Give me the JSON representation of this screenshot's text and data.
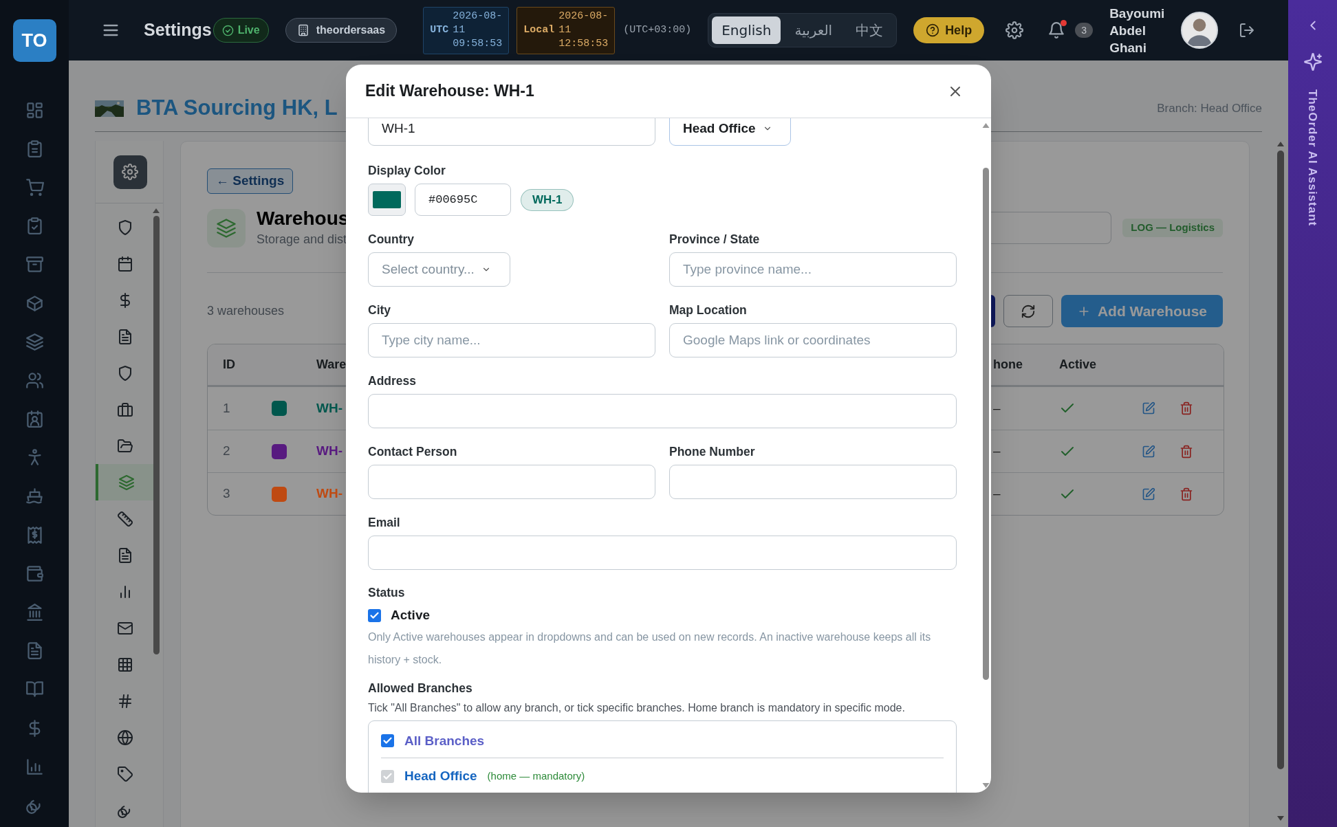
{
  "topbar": {
    "logo": "TO",
    "title": "Settings",
    "live": "Live",
    "tenant": "theordersaas",
    "clocks": [
      {
        "kind": "utc",
        "label": "UTC",
        "date": "2026-08-11",
        "time": "09:58:53"
      },
      {
        "kind": "local",
        "label": "Local",
        "date": "2026-08-11",
        "time": "12:58:53"
      }
    ],
    "timezone": "(UTC+03:00)",
    "languages": [
      {
        "label": "English",
        "selected": true
      },
      {
        "label": "العربية",
        "selected": false
      },
      {
        "label": "中文",
        "selected": false
      }
    ],
    "help": "Help",
    "notifications": "3",
    "user": "Bayoumi Abdel Ghani"
  },
  "ai_panel": {
    "title": "TheOrder AI Assistant"
  },
  "header": {
    "company": "BTA Sourcing HK, L",
    "branch": "Branch: Head Office"
  },
  "settings_nav": [
    {
      "selected": false
    },
    {
      "selected": false
    },
    {
      "selected": false
    },
    {
      "selected": false
    },
    {
      "selected": false
    },
    {
      "selected": false
    },
    {
      "selected": false
    },
    {
      "selected": true
    },
    {
      "selected": false
    },
    {
      "selected": false
    },
    {
      "selected": false
    },
    {
      "selected": false
    },
    {
      "selected": false
    },
    {
      "selected": false
    },
    {
      "selected": false
    },
    {
      "selected": false
    },
    {
      "selected": false
    }
  ],
  "back_button": "← Settings",
  "section": {
    "title": "Warehous",
    "subtitle": "Storage and dist",
    "department": "LOG — Logistics"
  },
  "summary": "3 warehouses",
  "add_button": "Add Warehouse",
  "table": {
    "columns": [
      "ID",
      "Ware",
      "hone",
      "Active"
    ],
    "rows": [
      {
        "id": "1",
        "name": "WH-",
        "color": "#00574d",
        "phone": "–",
        "active": true
      },
      {
        "id": "2",
        "name": "WH-",
        "color": "#581a80",
        "phone": "–",
        "active": true
      },
      {
        "id": "3",
        "name": "WH-",
        "color": "#bf4a12",
        "phone": "–",
        "active": true
      }
    ]
  },
  "modal": {
    "title": "Edit Warehouse: WH-1",
    "top_row": [
      {
        "kind": "text",
        "value": "WH-1"
      },
      {
        "kind": "select",
        "value": "Head Office"
      }
    ],
    "display_color": {
      "label": "Display Color",
      "color": "#00695c",
      "hex": "#00695C",
      "preview": "WH-1"
    },
    "rows": [
      [
        {
          "kind": "select",
          "label": "Country",
          "placeholder": "Select country..."
        },
        {
          "kind": "text",
          "label": "Province / State",
          "placeholder": "Type province name..."
        }
      ],
      [
        {
          "kind": "text",
          "label": "City",
          "placeholder": "Type city name..."
        },
        {
          "kind": "text",
          "label": "Map Location",
          "placeholder": "Google Maps link or coordinates"
        }
      ],
      [
        {
          "kind": "text",
          "label": "Address"
        }
      ],
      [
        {
          "kind": "text",
          "label": "Contact Person"
        },
        {
          "kind": "text",
          "label": "Phone Number"
        }
      ],
      [
        {
          "kind": "text",
          "label": "Email"
        }
      ]
    ],
    "status": {
      "label": "Status",
      "option": "Active",
      "checked": true,
      "help": "Only Active warehouses appear in dropdowns and can be used on new records. An inactive warehouse keeps all its history + stock."
    },
    "branches": {
      "label": "Allowed Branches",
      "help": "Tick \"All Branches\" to allow any branch, or tick specific branches. Home branch is mandatory in specific mode.",
      "options": [
        {
          "kind": "all",
          "label": "All Branches",
          "checked": true,
          "disabled": false
        },
        {
          "kind": "branch",
          "label": "Head Office",
          "note": "(home — mandatory)",
          "checked": true,
          "disabled": true
        }
      ]
    }
  }
}
